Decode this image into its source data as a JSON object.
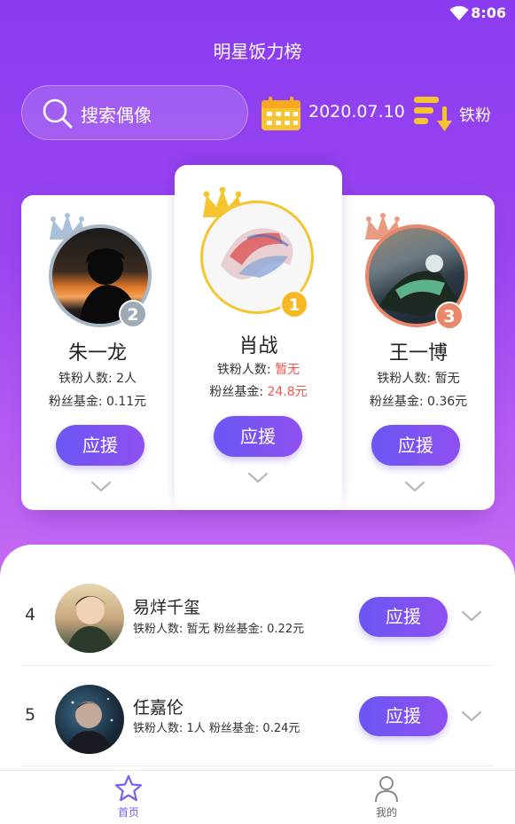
{
  "status_bar": {
    "time": "8:06"
  },
  "header": {
    "title": "明星饭力榜",
    "search_placeholder": "搜索偶像",
    "date": "2020.07.10",
    "sort_label": "铁粉"
  },
  "top3": [
    {
      "rank": "2",
      "name": "朱一龙",
      "fans_label": "铁粉人数:",
      "fans_value": "2人",
      "fund_label": "粉丝基金:",
      "fund_value": "0.11元",
      "button": "应援"
    },
    {
      "rank": "1",
      "name": "肖战",
      "fans_label": "铁粉人数:",
      "fans_value": "暂无",
      "fund_label": "粉丝基金:",
      "fund_value": "24.8元",
      "button": "应援"
    },
    {
      "rank": "3",
      "name": "王一博",
      "fans_label": "铁粉人数:",
      "fans_value": "暂无",
      "fund_label": "粉丝基金:",
      "fund_value": "0.36元",
      "button": "应援"
    }
  ],
  "list": [
    {
      "rank": "4",
      "name": "易烊千玺",
      "stats": "铁粉人数: 暂无    粉丝基金: 0.22元",
      "button": "应援"
    },
    {
      "rank": "5",
      "name": "任嘉伦",
      "stats": "铁粉人数: 1人    粉丝基金: 0.24元",
      "button": "应援"
    }
  ],
  "nav": [
    {
      "label": "首页",
      "active": true
    },
    {
      "label": "我的",
      "active": false
    }
  ],
  "colors": {
    "accent": "#7a5cf5",
    "gold": "#f6c430",
    "silver": "#9eaab6",
    "bronze": "#e8876a",
    "highlight_red": "#f2554d"
  }
}
